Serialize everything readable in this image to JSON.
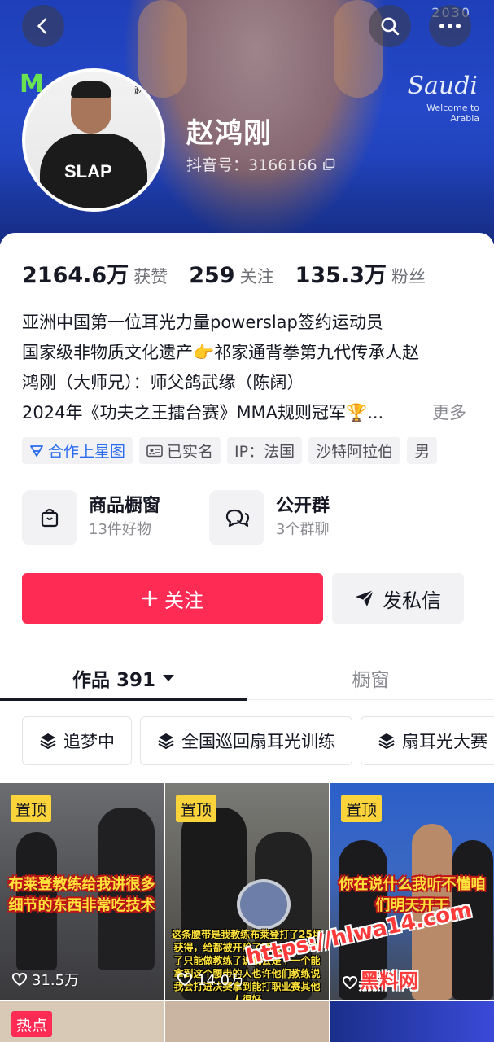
{
  "header": {
    "brand_top": "2030",
    "brand_saudi": "Saudi",
    "brand_sub": "Welcome to Arabia",
    "brand_m": "M"
  },
  "profile": {
    "name": "赵鸿刚",
    "douyin_id": "抖音号：3166166",
    "avatar_logo": "SLAP",
    "avatar_signature": "赵"
  },
  "stats": [
    {
      "value": "2164.6万",
      "label": "获赞"
    },
    {
      "value": "259",
      "label": "关注"
    },
    {
      "value": "135.3万",
      "label": "粉丝"
    }
  ],
  "bio": {
    "line1": "亚洲中国第一位耳光力量powerslap签约运动员",
    "line2": "国家级非物质文化遗产👉祁家通背拳第九代传承人赵",
    "line3": "鸿刚（大师兄）：师父鸽武缘（陈阔）",
    "line4": "2024年《功夫之王擂台赛》MMA规则冠军🏆...",
    "more": "更多"
  },
  "tags": [
    {
      "label": "合作上星图"
    },
    {
      "label": "已实名"
    },
    {
      "label": "IP：法国"
    },
    {
      "label": "沙特阿拉伯"
    },
    {
      "label": "男"
    }
  ],
  "services": [
    {
      "title": "商品橱窗",
      "sub": "13件好物"
    },
    {
      "title": "公开群",
      "sub": "3个群聊"
    }
  ],
  "actions": {
    "follow": "关注",
    "message": "发私信"
  },
  "tabs": {
    "works": "作品 391",
    "shop": "橱窗"
  },
  "collections": [
    {
      "label": "追梦中"
    },
    {
      "label": "全国巡回扇耳光训练"
    },
    {
      "label": "扇耳光大赛"
    }
  ],
  "videos": [
    {
      "badge": "置顶",
      "caption": "布莱登教练给我讲很多细节的东西非常吃技术",
      "likes": "31.5万"
    },
    {
      "badge": "置顶",
      "caption": "这条腰带是我教练布莱登打了25场获得，给都被开除了两次不能比赛了只能做教练了说我会是下一个能拿到这个腰带的人也许他们教练说我会打进决赛拿到能打职业赛其他人很好",
      "likes": "14.0万"
    },
    {
      "badge": "置顶",
      "caption": "你在说什么我听不懂咱们明天开干",
      "likes": ""
    },
    {
      "badge": "热点"
    }
  ],
  "watermarks": {
    "url": "https://hlwa14.com",
    "site": "黑料网"
  },
  "colors": {
    "accent": "#fe2c55",
    "cover_blue": "#2448c8",
    "badge_yellow": "#fbd33b",
    "star_blue": "#2a6cf0"
  }
}
